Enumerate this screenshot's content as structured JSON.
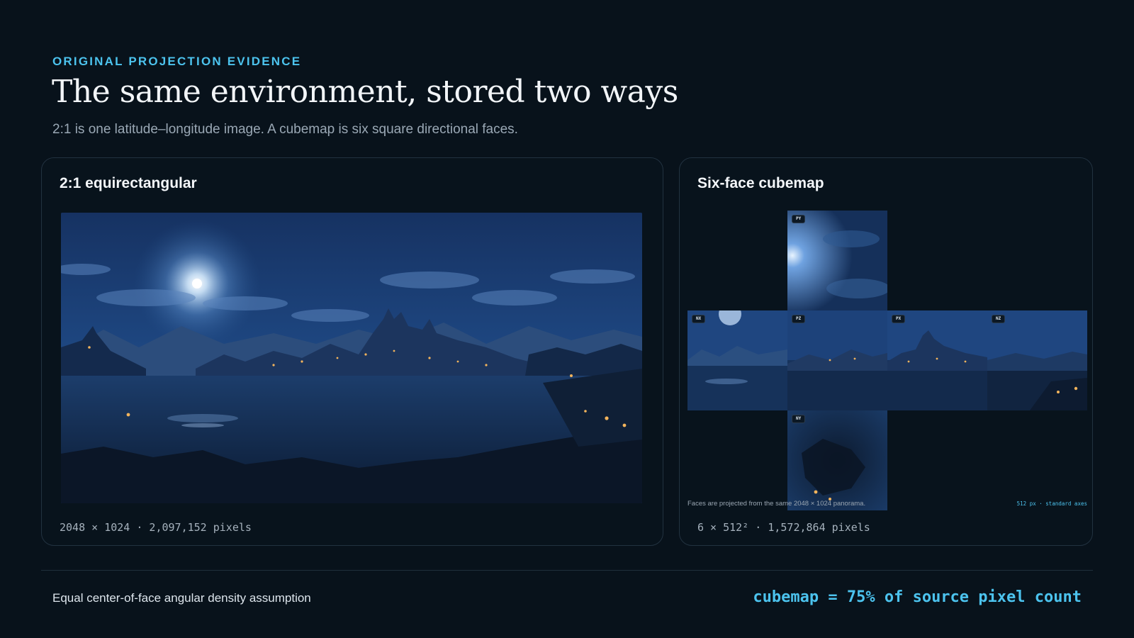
{
  "header": {
    "eyebrow": "ORIGINAL PROJECTION EVIDENCE",
    "title": "The same environment, stored two ways",
    "subtitle": "2:1 is one latitude–longitude image. A cubemap is six square directional faces."
  },
  "equirect_panel": {
    "title": "2:1 equirectangular",
    "meta": "2048 × 1024 · 2,097,152 pixels"
  },
  "cubemap_panel": {
    "title": "Six-face cubemap",
    "meta": "6 × 512² · 1,572,864 pixels",
    "faces": {
      "py": "PY",
      "nx": "NX",
      "pz": "PZ",
      "px": "PX",
      "nz": "NZ",
      "ny": "NY"
    },
    "note": "Faces are projected from the same 2048 × 1024 panorama.",
    "axes_label": "512 px · standard axes"
  },
  "footer": {
    "left": "Equal center-of-face angular density assumption",
    "right": "cubemap = 75% of source pixel count"
  },
  "colors": {
    "accent": "#4cc3ee",
    "background": "#08121b",
    "sky": "#1a3a6b",
    "water": "#0f2340",
    "light": "#f3b45c"
  }
}
